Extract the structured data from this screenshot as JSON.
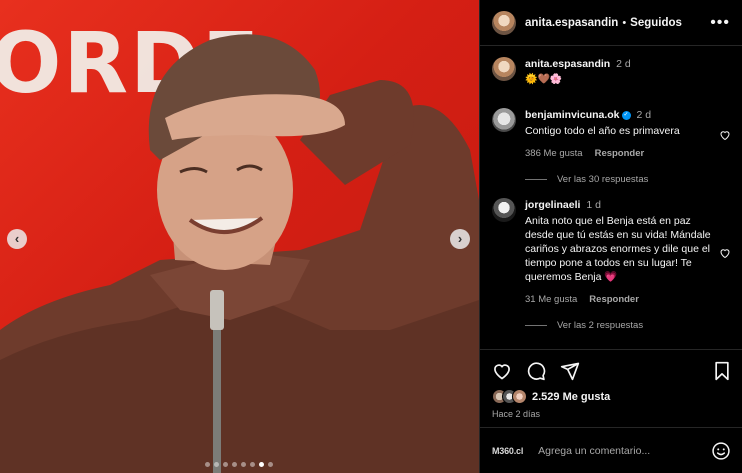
{
  "photo": {
    "brand_text": "ORDE",
    "dot_count": 8,
    "active_dot": 6,
    "prev_icon": "chevron-left-icon",
    "next_icon": "chevron-right-icon",
    "prev_glyph": "‹",
    "next_glyph": "›"
  },
  "header": {
    "username": "anita.espasandin",
    "separator": "•",
    "follow_status": "Seguidos",
    "more_glyph": "•••"
  },
  "caption": {
    "username": "anita.espasandin",
    "time": "2 d",
    "text": "🌞🤎🌸"
  },
  "comments": [
    {
      "username": "benjaminvicuna.ok",
      "verified": true,
      "verified_glyph": "✓",
      "time": "2 d",
      "text": "Contigo todo el año es primavera",
      "likes": "386 Me gusta",
      "reply_label": "Responder",
      "view_replies": "Ver las 30 respuestas"
    },
    {
      "username": "jorgelinaeli",
      "verified": false,
      "time": "1 d",
      "text": "Anita noto que el Benja está en paz desde que tú estás en su vida! Mándale cariños y abrazos enormes y dile que el tiempo pone a todos en su lugar! Te queremos Benja 💗",
      "likes": "31 Me gusta",
      "reply_label": "Responder",
      "view_replies": "Ver las 2 respuestas"
    }
  ],
  "actions": {
    "like_icon": "heart-icon",
    "comment_icon": "comment-icon",
    "share_icon": "send-icon",
    "save_icon": "bookmark-icon",
    "likes_count": "2.529 Me gusta",
    "time_ago": "Hace 2 días"
  },
  "composer": {
    "watermark": "M360.cl",
    "placeholder": "Agrega un comentario...",
    "emoji_icon": "smiley-icon"
  },
  "colors": {
    "photo_bg": "#d51f14",
    "verified": "#0095f6",
    "muted": "#a8a8a8"
  }
}
